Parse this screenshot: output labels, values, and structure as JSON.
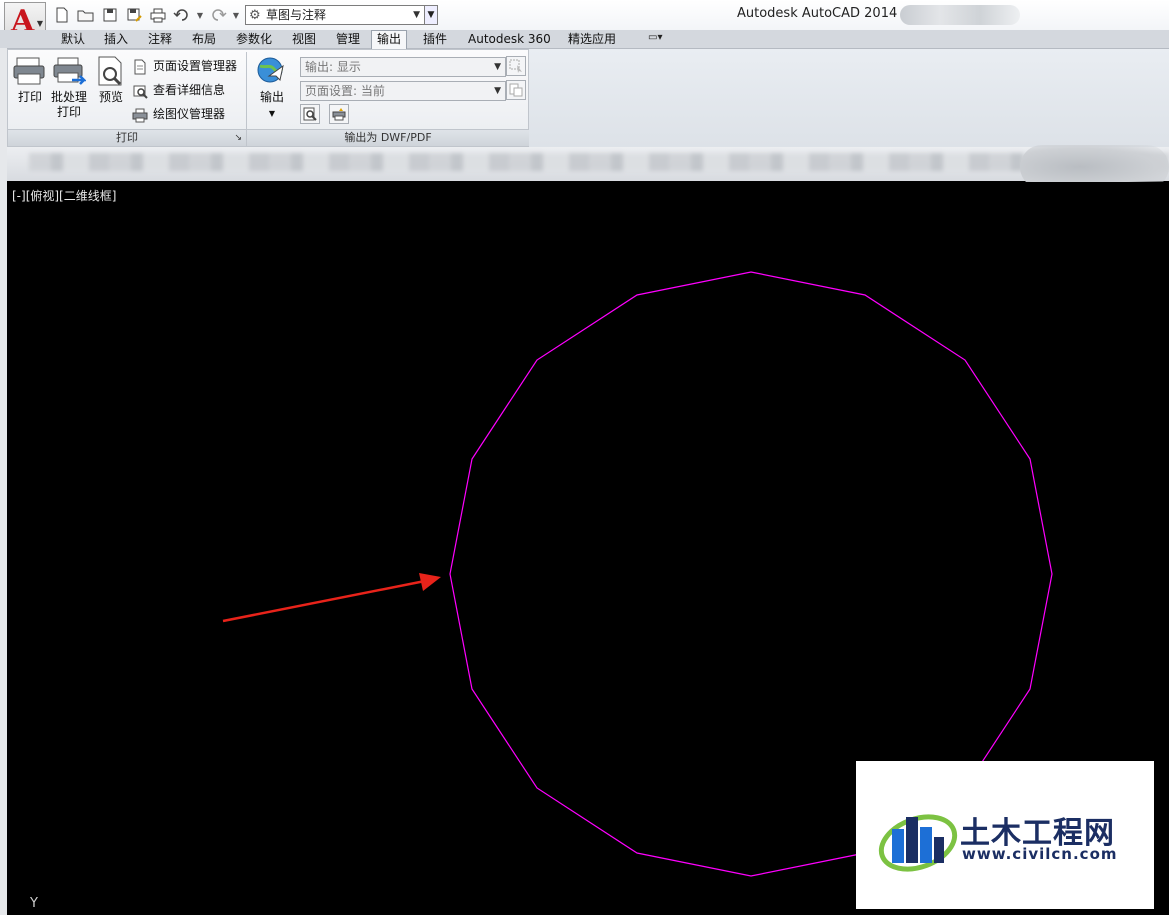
{
  "title_bar": {
    "app_title": "Autodesk AutoCAD 2014",
    "workspace": "草图与注释",
    "quick_access": [
      "new-icon",
      "open-icon",
      "save-icon",
      "save-as-icon",
      "plot-icon",
      "undo-icon",
      "redo-icon"
    ]
  },
  "ribbon_tabs": [
    {
      "label": "默认",
      "active": false
    },
    {
      "label": "插入",
      "active": false
    },
    {
      "label": "注释",
      "active": false
    },
    {
      "label": "布局",
      "active": false
    },
    {
      "label": "参数化",
      "active": false
    },
    {
      "label": "视图",
      "active": false
    },
    {
      "label": "管理",
      "active": false
    },
    {
      "label": "输出",
      "active": true
    },
    {
      "label": "插件",
      "active": false
    },
    {
      "label": "Autodesk 360",
      "active": false
    },
    {
      "label": "精选应用",
      "active": false
    }
  ],
  "print_panel": {
    "title": "打印",
    "plot_label": "打印",
    "batch_plot_label_1": "批处理",
    "batch_plot_label_2": "打印",
    "preview_label": "预览",
    "page_setup_manager": "页面设置管理器",
    "view_details": "查看详细信息",
    "plotter_manager": "绘图仪管理器"
  },
  "export_panel": {
    "title": "输出为 DWF/PDF",
    "export_label": "输出",
    "export_combo": "输出: 显示",
    "page_setup_combo": "页面设置: 当前"
  },
  "viewport": {
    "label": "[-][俯视][二维线框]",
    "ucs_axis": "Y",
    "shape_color": "#ff00ff",
    "arrow_color": "#e8231a"
  },
  "watermark": {
    "name_cn": "土木工程网",
    "url": "www.civilcn.com"
  },
  "colors": {
    "canvas": "#000000",
    "autocad_red": "#c8161d",
    "watermark_blue": "#1b2e63",
    "watermark_green": "#7cc242"
  }
}
